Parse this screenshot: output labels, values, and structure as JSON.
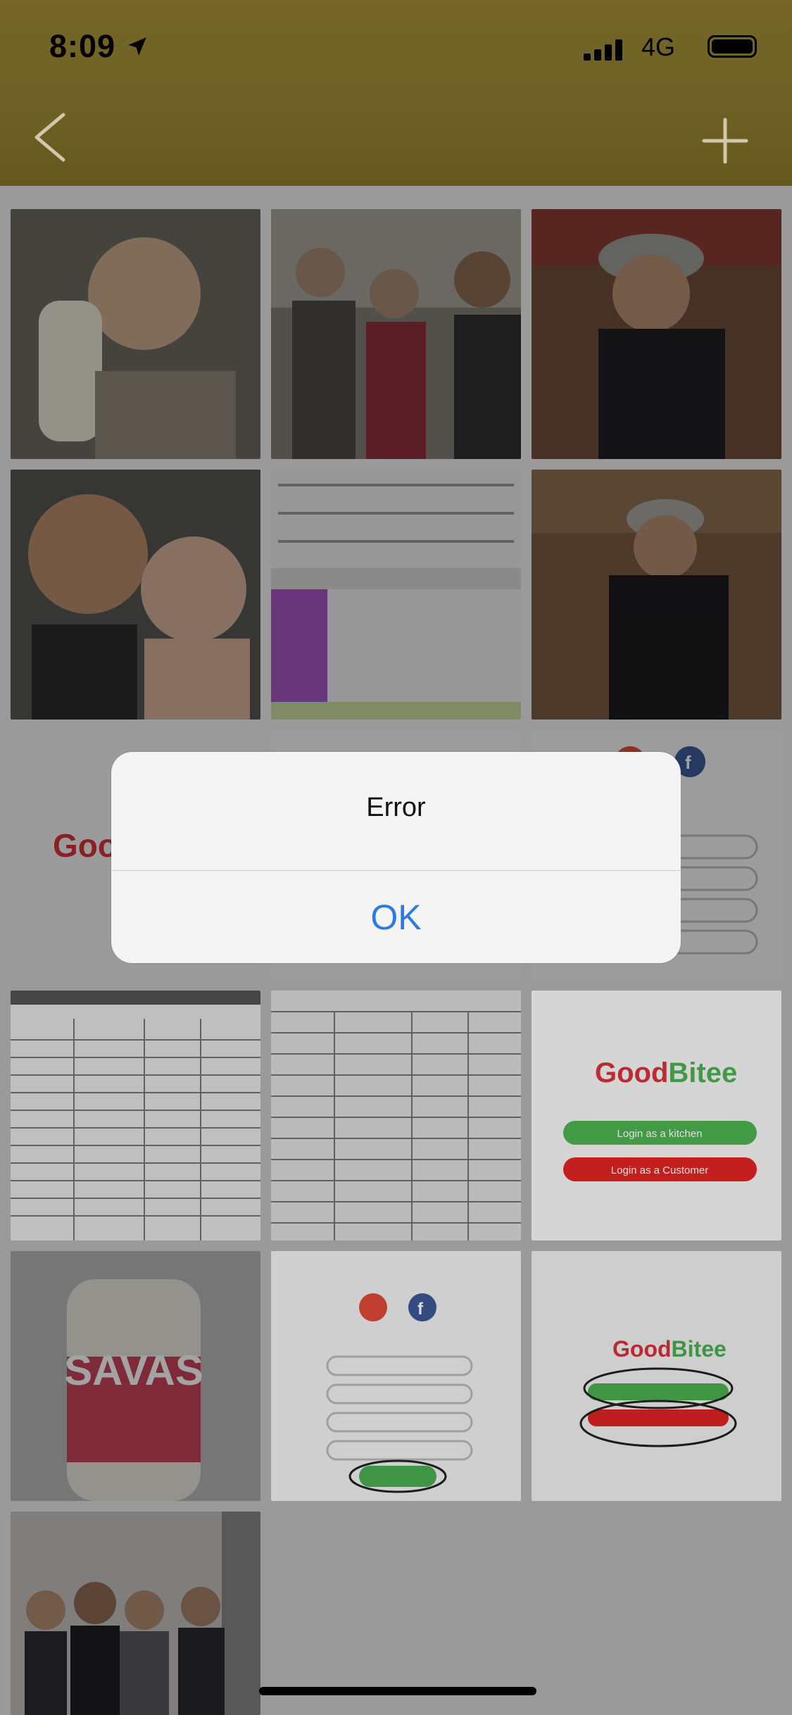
{
  "status_bar": {
    "time": "8:09",
    "location_icon": "location-arrow-icon",
    "signal_icon": "cellular-signal-icon",
    "network": "4G",
    "battery_icon": "battery-full-icon"
  },
  "nav": {
    "back_icon": "chevron-left-icon",
    "add_icon": "plus-icon"
  },
  "gallery": {
    "items": [
      {
        "name": "baby-bottle-photo"
      },
      {
        "name": "group-street-photo"
      },
      {
        "name": "man-hat-photo"
      },
      {
        "name": "man-baby-photo"
      },
      {
        "name": "calendar-screenshot"
      },
      {
        "name": "man-seated-photo"
      },
      {
        "name": "goodbitee-logo-screenshot"
      },
      {
        "name": "list-screenshot"
      },
      {
        "name": "signup-form-screenshot"
      },
      {
        "name": "handwritten-sheet-photo"
      },
      {
        "name": "handwritten-sheet-photo-2"
      },
      {
        "name": "goodbitee-login-screenshot"
      },
      {
        "name": "protein-drink-photo"
      },
      {
        "name": "login-form-screenshot"
      },
      {
        "name": "goodbitee-annotated-screenshot"
      },
      {
        "name": "office-group-photo"
      }
    ],
    "logo_text": "GoodBitee",
    "login_kitchen": "Login as a kitchen",
    "login_customer": "Login as a Customer"
  },
  "alert": {
    "title": "Error",
    "ok_label": "OK"
  },
  "colors": {
    "header": "#756527",
    "alert_bg": "#f4f4f4",
    "ok_blue": "#2c7be5",
    "brand_green": "#4caf50",
    "brand_red": "#e02424"
  }
}
